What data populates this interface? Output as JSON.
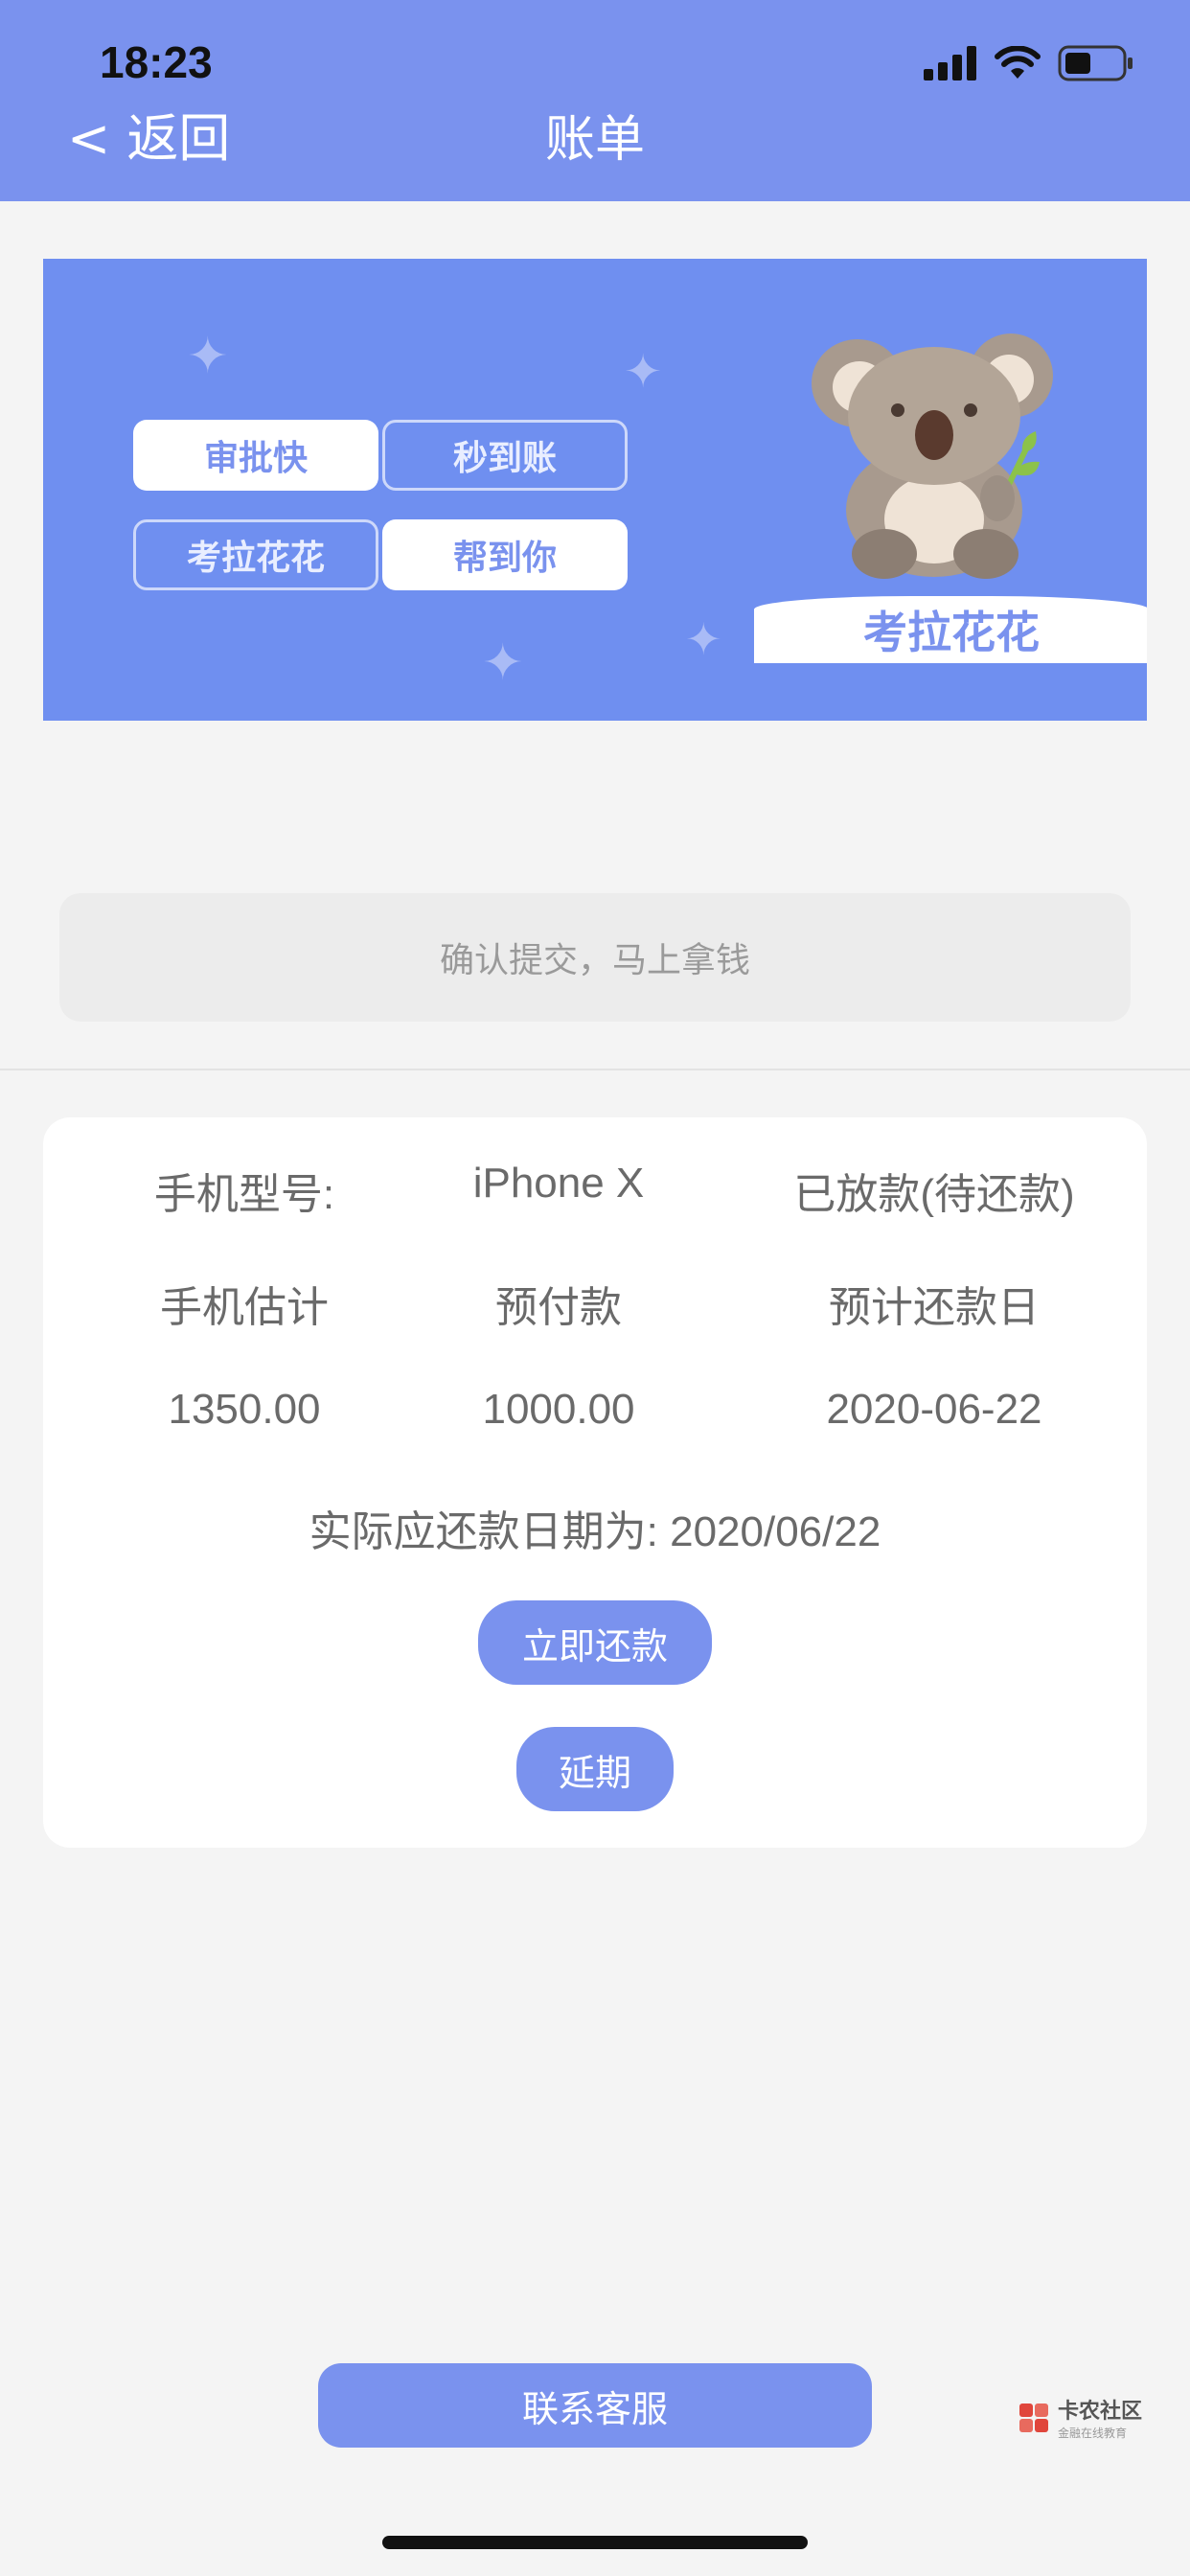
{
  "status": {
    "time": "18:23"
  },
  "header": {
    "back_label": "< 返回",
    "title": "账单"
  },
  "banner": {
    "chips": [
      "审批快",
      "秒到账",
      "考拉花花",
      "帮到你"
    ],
    "brand_label": "考拉花花"
  },
  "submit": {
    "label": "确认提交，马上拿钱"
  },
  "bill": {
    "row1": [
      "手机型号:",
      "iPhone X",
      "已放款(待还款)"
    ],
    "row2": [
      "手机估计",
      "预付款",
      "预计还款日"
    ],
    "row3": [
      "1350.00",
      "1000.00",
      "2020-06-22"
    ],
    "due_text": "实际应还款日期为: 2020/06/22",
    "repay_label": "立即还款",
    "extend_label": "延期"
  },
  "footer": {
    "service_label": "联系客服"
  },
  "watermark": {
    "main": "卡农社区",
    "sub": "金融在线教育"
  },
  "colors": {
    "accent": "#7a92ee",
    "banner": "#6f8ff0",
    "background": "#f4f4f4"
  }
}
